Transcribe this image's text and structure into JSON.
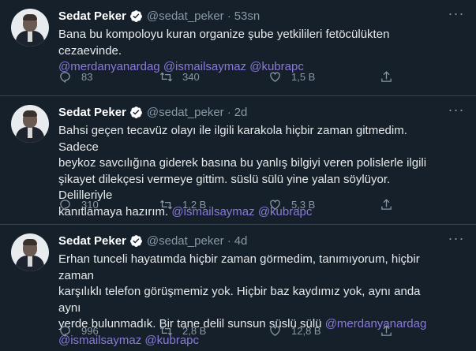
{
  "tweets": [
    {
      "name": "Sedat Peker",
      "handle": "@sedat_peker",
      "time": "53sn",
      "text_main": "Bana bu kompoloyu kuran organize şube yetkilileri fetöcülükten cezaevinde.",
      "mentions": [
        "@merdanyanardag",
        "@ismailsaymaz",
        "@kubrapc"
      ],
      "replies": "83",
      "retweets": "340",
      "likes": "1,5 B"
    },
    {
      "name": "Sedat Peker",
      "handle": "@sedat_peker",
      "time": "2d",
      "line1": "Bahsi geçen tecavüz olayı ile ilgili karakola hiçbir zaman gitmedim. Sadece",
      "line2": "beykoz savcılığına giderek basına bu yanlış bilgiyi veren polislerle ilgili",
      "line3": "şikayet dilekçesi vermeye gittim. süslü sülü yine yalan söylüyor. Delilleriyle",
      "line4": "kanıtlamaya hazırım.",
      "mentions": [
        "@ismailsaymaz",
        "@kubrapc"
      ],
      "replies": "310",
      "retweets": "1,2 B",
      "likes": "5,3 B"
    },
    {
      "name": "Sedat Peker",
      "handle": "@sedat_peker",
      "time": "4d",
      "line1": "Erhan tunceli hayatımda hiçbir zaman görmedim, tanımıyorum, hiçbir zaman",
      "line2": "karşılıklı telefon görüşmemiz yok. Hiçbir baz kaydımız yok, aynı anda aynı",
      "line3": "yerde bulunmadık. Bir tane delil sunsun süslü sülü",
      "mentions": [
        "@merdanyanardag",
        "@ismailsaymaz",
        "@kubrapc"
      ],
      "replies": "996",
      "retweets": "2,8 B",
      "likes": "12,8 B"
    }
  ],
  "icons": {
    "verified": "verified-badge-icon",
    "more": "more-icon",
    "reply": "reply-icon",
    "retweet": "retweet-icon",
    "like": "like-icon",
    "share": "share-icon"
  },
  "colors": {
    "background": "#15202b",
    "mention": "#8a7ad9",
    "verified": "#1d9bf0",
    "muted": "#8899a6"
  }
}
